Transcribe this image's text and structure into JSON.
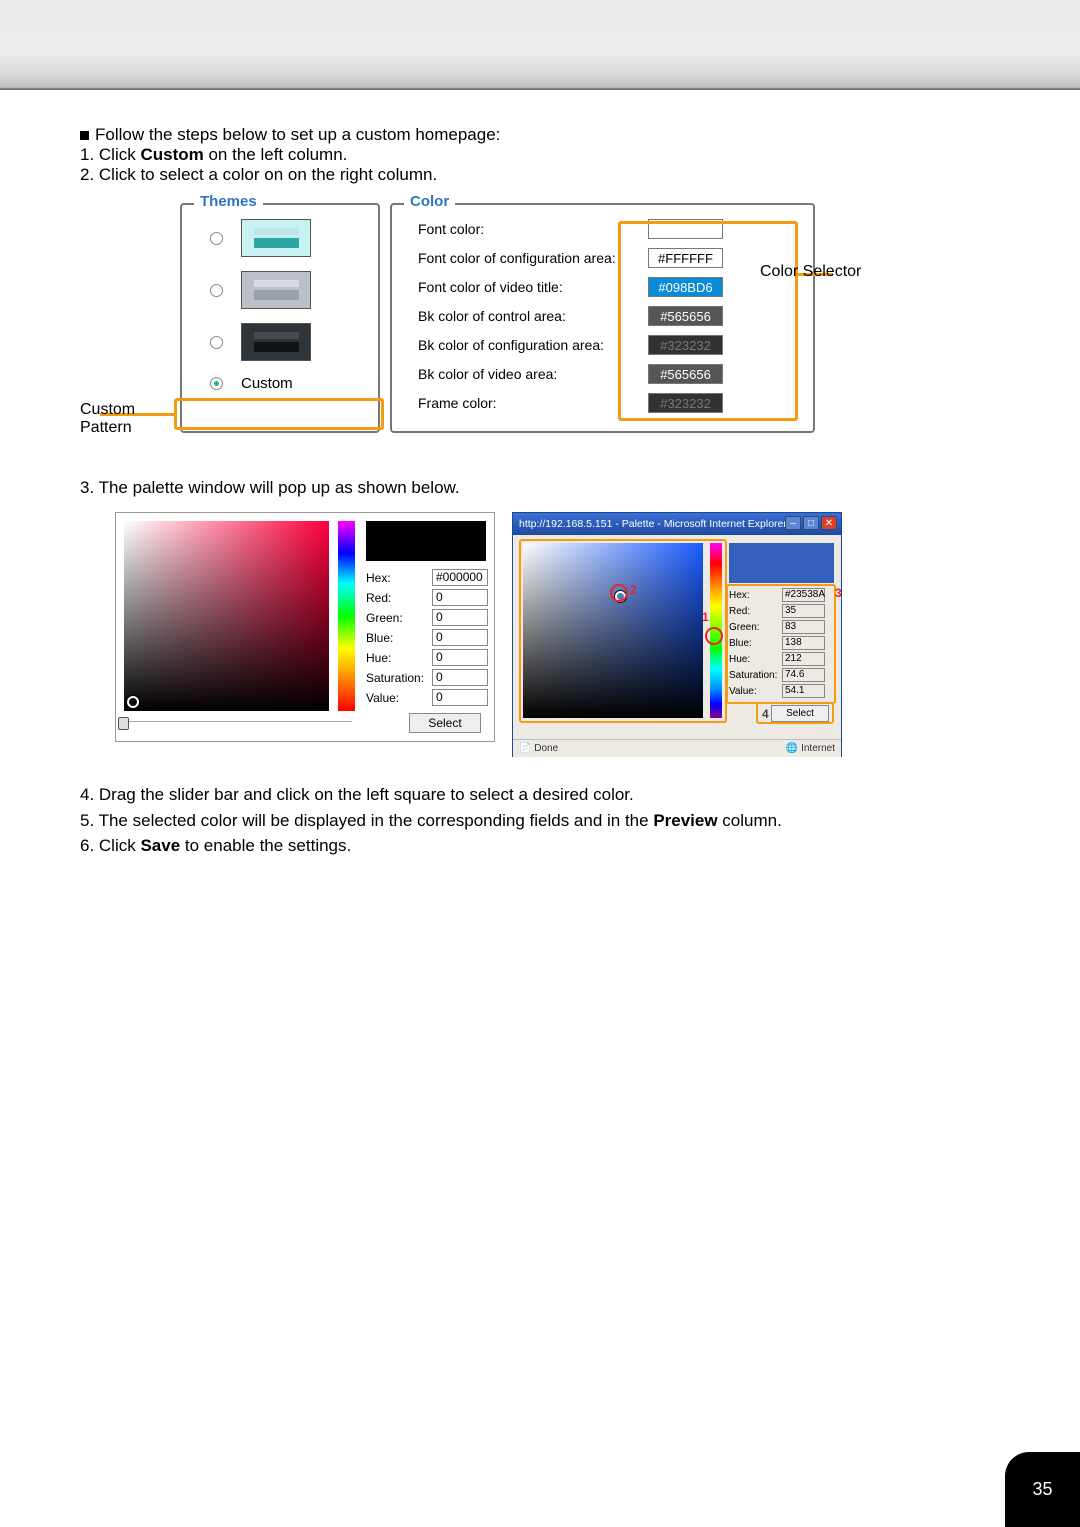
{
  "top_text": {
    "bullet_line": "Follow the steps below to set up a custom homepage:",
    "step1_pre": "1. Click ",
    "step1_bold": "Custom",
    "step1_post": " on the left column.",
    "step2": "2. Click to select a color on on the right column."
  },
  "fig1": {
    "themes_legend": "Themes",
    "color_legend": "Color",
    "custom": "Custom",
    "callout_custom": "Custom\nPattern",
    "callout_selector": "Color Selector",
    "rows": [
      {
        "label": "Font color:",
        "val": "",
        "cls": "cv-blank"
      },
      {
        "label": "Font color of configuration area:",
        "val": "#FFFFFF",
        "cls": "cv-white"
      },
      {
        "label": "Font color of video title:",
        "val": "#098BD6",
        "cls": "cv-blue"
      },
      {
        "label": "Bk color of control area:",
        "val": "#565656",
        "cls": "cv-56"
      },
      {
        "label": "Bk color of configuration area:",
        "val": "#323232",
        "cls": "cv-32"
      },
      {
        "label": "Bk color of video area:",
        "val": "#565656",
        "cls": "cv-56"
      },
      {
        "label": "Frame color:",
        "val": "#323232",
        "cls": "cv-32"
      }
    ]
  },
  "step3": "3. The palette window will pop up as shown below.",
  "palA": {
    "hex_l": "Hex:",
    "hex_v": "#000000",
    "r_l": "Red:",
    "r_v": "0",
    "g_l": "Green:",
    "g_v": "0",
    "b_l": "Blue:",
    "b_v": "0",
    "h_l": "Hue:",
    "h_v": "0",
    "s_l": "Saturation:",
    "s_v": "0",
    "v_l": "Value:",
    "v_v": "0",
    "select": "Select"
  },
  "palB": {
    "title": "http://192.168.5.151 - Palette - Microsoft Internet Explorer",
    "hex_l": "Hex:",
    "hex_v": "#23538A",
    "r_l": "Red:",
    "r_v": "35",
    "g_l": "Green:",
    "g_v": "83",
    "b_l": "Blue:",
    "b_v": "138",
    "h_l": "Hue:",
    "h_v": "212",
    "s_l": "Saturation:",
    "s_v": "74.6",
    "v_l": "Value:",
    "v_v": "54.1",
    "select": "Select",
    "done": "Done",
    "internet": "Internet",
    "n1": "1",
    "n2": "2",
    "n3": "3",
    "n4": "4"
  },
  "steps_tail": {
    "s4": "4. Drag the slider bar and click on the left square to select a desired color.",
    "s5_pre": "5. The selected color will be displayed in the corresponding fields and in the ",
    "s5_bold": "Preview",
    "s5_post": " column.",
    "s6_pre": "6. Click ",
    "s6_bold": "Save",
    "s6_post": " to enable the settings."
  },
  "page_number": "35"
}
